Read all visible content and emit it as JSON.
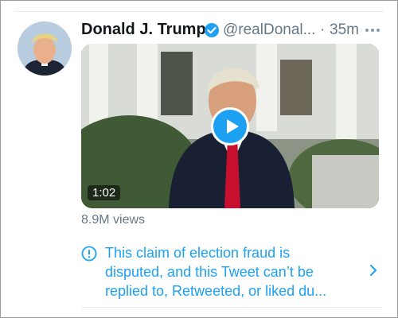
{
  "tweet": {
    "display_name": "Donald J. Trump",
    "handle": "@realDonal...",
    "separator": "·",
    "time": "35m",
    "verified": true,
    "more_icon": "more-horizontal-icon"
  },
  "video": {
    "duration": "1:02",
    "play_icon": "play-icon"
  },
  "stats": {
    "views": "8.9M views"
  },
  "notice": {
    "icon": "info-circle-icon",
    "line1": "This claim of election fraud is",
    "line2": "disputed, and this Tweet can’t be",
    "line3": "replied to, Retweeted, or liked du...",
    "chevron_icon": "chevron-right-icon"
  },
  "colors": {
    "accent": "#1da1f2",
    "secondary_text": "#657786",
    "primary_text": "#14171a"
  }
}
